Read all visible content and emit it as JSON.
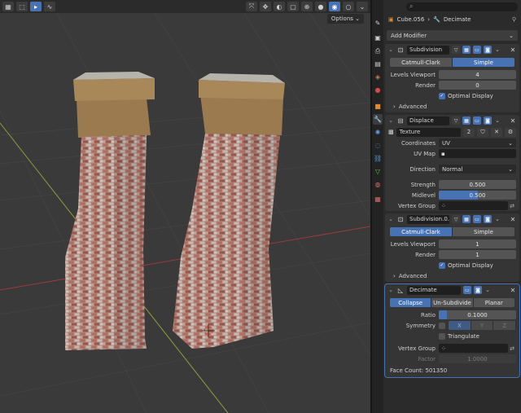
{
  "viewport": {
    "options_label": "Options",
    "header_icons": [
      "editor-type-icon",
      "select-mode-icon",
      "view-menu-icon",
      "gizmo-icon",
      "overlay-icon",
      "shading-icon"
    ],
    "colors": {
      "background": "#3a3a3a",
      "grid": "#4a4a4a",
      "x_axis": "#9a3b3b",
      "y_axis": "#7c9a3b"
    }
  },
  "properties": {
    "breadcrumb": {
      "object": "Cube.056",
      "modifier": "Decimate"
    },
    "add_modifier_label": "Add Modifier",
    "modifiers": [
      {
        "name": "Subdivision",
        "modes": [
          "Catmull-Clark",
          "Simple"
        ],
        "active_mode": "Simple",
        "levels_viewport_label": "Levels Viewport",
        "levels_viewport": "4",
        "render_label": "Render",
        "render": "0",
        "optimal_display_label": "Optimal Display",
        "advanced_label": "Advanced"
      },
      {
        "name": "Displace",
        "texture_name": "Texture",
        "texture_users": "2",
        "coordinates_label": "Coordinates",
        "coordinates": "UV",
        "uv_map_label": "UV Map",
        "uv_map": "",
        "direction_label": "Direction",
        "direction": "Normal",
        "strength_label": "Strength",
        "strength": "0.500",
        "midlevel_label": "Midlevel",
        "midlevel": "0.500",
        "midlevel_fill": 0.5,
        "vertex_group_label": "Vertex Group"
      },
      {
        "name": "Subdivision.0...",
        "modes": [
          "Catmull-Clark",
          "Simple"
        ],
        "active_mode": "Catmull-Clark",
        "levels_viewport_label": "Levels Viewport",
        "levels_viewport": "1",
        "render_label": "Render",
        "render": "1",
        "optimal_display_label": "Optimal Display",
        "advanced_label": "Advanced"
      },
      {
        "name": "Decimate",
        "modes": [
          "Collapse",
          "Un-Subdivide",
          "Planar"
        ],
        "active_mode": "Collapse",
        "ratio_label": "Ratio",
        "ratio": "0.1000",
        "ratio_fill": 0.1,
        "symmetry_label": "Symmetry",
        "symmetry_axes": [
          "X",
          "Y",
          "Z"
        ],
        "triangulate_label": "Triangulate",
        "vertex_group_label": "Vertex Group",
        "factor_label": "Factor",
        "factor": "1.0000",
        "face_count_label": "Face Count:",
        "face_count": "501350"
      }
    ]
  }
}
